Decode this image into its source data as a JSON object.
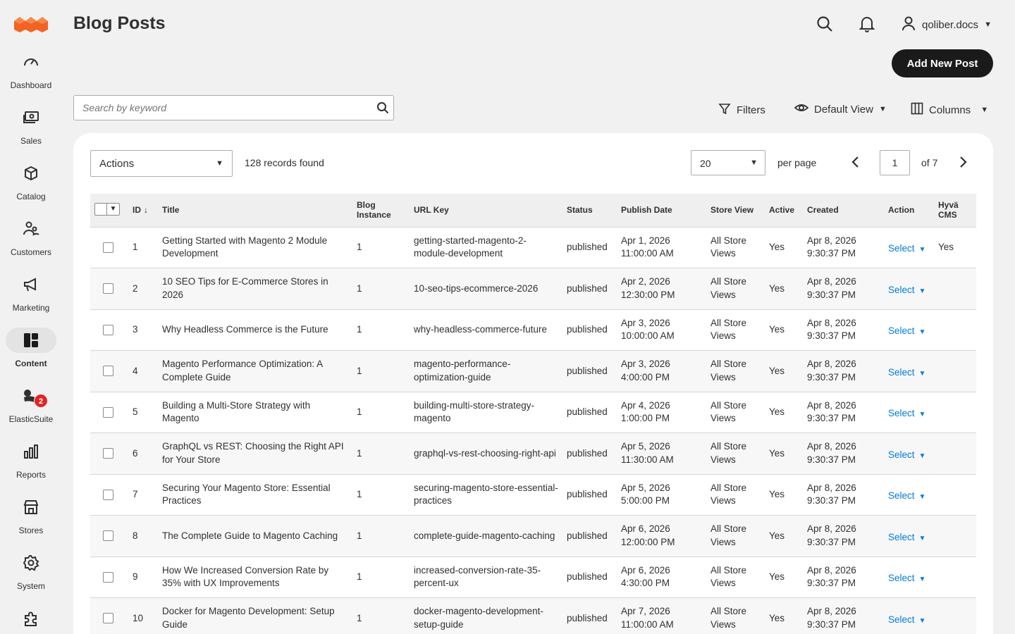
{
  "sidebar": {
    "items": [
      {
        "label": "Dashboard",
        "icon": "dashboard-icon"
      },
      {
        "label": "Sales",
        "icon": "sales-icon"
      },
      {
        "label": "Catalog",
        "icon": "catalog-icon"
      },
      {
        "label": "Customers",
        "icon": "customers-icon"
      },
      {
        "label": "Marketing",
        "icon": "marketing-icon"
      },
      {
        "label": "Content",
        "icon": "content-icon",
        "active": true
      },
      {
        "label": "ElasticSuite",
        "icon": "elasticsuite-icon",
        "badge": "2"
      },
      {
        "label": "Reports",
        "icon": "reports-icon"
      },
      {
        "label": "Stores",
        "icon": "stores-icon"
      },
      {
        "label": "System",
        "icon": "system-icon"
      },
      {
        "label": "",
        "icon": "extensions-icon"
      }
    ]
  },
  "header": {
    "title": "Blog Posts",
    "username": "qoliber.docs",
    "add_button": "Add New Post"
  },
  "search": {
    "placeholder": "Search by keyword"
  },
  "toolbar": {
    "filters": "Filters",
    "view": "Default View",
    "columns": "Columns"
  },
  "grid": {
    "actions_label": "Actions",
    "records_found": "128 records found",
    "per_page_value": "20",
    "per_page_label": "per page",
    "current_page": "1",
    "of_pages": "of 7",
    "columns": {
      "id": "ID",
      "title": "Title",
      "blog_instance": "Blog Instance",
      "url_key": "URL Key",
      "status": "Status",
      "publish_date": "Publish Date",
      "store_view": "Store View",
      "active": "Active",
      "created": "Created",
      "action": "Action",
      "hyva_cms": "Hyvä CMS"
    },
    "rows": [
      {
        "id": "1",
        "title": "Getting Started with Magento 2 Module Development",
        "blog_instance": "1",
        "url_key": "getting-started-magento-2-module-development",
        "status": "published",
        "publish_date": "Apr 1, 2026 11:00:00 AM",
        "store_view": "All Store Views",
        "active": "Yes",
        "created": "Apr 8, 2026 9:30:37 PM",
        "action": "Select",
        "hyva_cms": "Yes"
      },
      {
        "id": "2",
        "title": "10 SEO Tips for E-Commerce Stores in 2026",
        "blog_instance": "1",
        "url_key": "10-seo-tips-ecommerce-2026",
        "status": "published",
        "publish_date": "Apr 2, 2026 12:30:00 PM",
        "store_view": "All Store Views",
        "active": "Yes",
        "created": "Apr 8, 2026 9:30:37 PM",
        "action": "Select",
        "hyva_cms": ""
      },
      {
        "id": "3",
        "title": "Why Headless Commerce is the Future",
        "blog_instance": "1",
        "url_key": "why-headless-commerce-future",
        "status": "published",
        "publish_date": "Apr 3, 2026 10:00:00 AM",
        "store_view": "All Store Views",
        "active": "Yes",
        "created": "Apr 8, 2026 9:30:37 PM",
        "action": "Select",
        "hyva_cms": ""
      },
      {
        "id": "4",
        "title": "Magento Performance Optimization: A Complete Guide",
        "blog_instance": "1",
        "url_key": "magento-performance-optimization-guide",
        "status": "published",
        "publish_date": "Apr 3, 2026 4:00:00 PM",
        "store_view": "All Store Views",
        "active": "Yes",
        "created": "Apr 8, 2026 9:30:37 PM",
        "action": "Select",
        "hyva_cms": ""
      },
      {
        "id": "5",
        "title": "Building a Multi-Store Strategy with Magento",
        "blog_instance": "1",
        "url_key": "building-multi-store-strategy-magento",
        "status": "published",
        "publish_date": "Apr 4, 2026 1:00:00 PM",
        "store_view": "All Store Views",
        "active": "Yes",
        "created": "Apr 8, 2026 9:30:37 PM",
        "action": "Select",
        "hyva_cms": ""
      },
      {
        "id": "6",
        "title": "GraphQL vs REST: Choosing the Right API for Your Store",
        "blog_instance": "1",
        "url_key": "graphql-vs-rest-choosing-right-api",
        "status": "published",
        "publish_date": "Apr 5, 2026 11:30:00 AM",
        "store_view": "All Store Views",
        "active": "Yes",
        "created": "Apr 8, 2026 9:30:37 PM",
        "action": "Select",
        "hyva_cms": ""
      },
      {
        "id": "7",
        "title": "Securing Your Magento Store: Essential Practices",
        "blog_instance": "1",
        "url_key": "securing-magento-store-essential-practices",
        "status": "published",
        "publish_date": "Apr 5, 2026 5:00:00 PM",
        "store_view": "All Store Views",
        "active": "Yes",
        "created": "Apr 8, 2026 9:30:37 PM",
        "action": "Select",
        "hyva_cms": ""
      },
      {
        "id": "8",
        "title": "The Complete Guide to Magento Caching",
        "blog_instance": "1",
        "url_key": "complete-guide-magento-caching",
        "status": "published",
        "publish_date": "Apr 6, 2026 12:00:00 PM",
        "store_view": "All Store Views",
        "active": "Yes",
        "created": "Apr 8, 2026 9:30:37 PM",
        "action": "Select",
        "hyva_cms": ""
      },
      {
        "id": "9",
        "title": "How We Increased Conversion Rate by 35% with UX Improvements",
        "blog_instance": "1",
        "url_key": "increased-conversion-rate-35-percent-ux",
        "status": "published",
        "publish_date": "Apr 6, 2026 4:30:00 PM",
        "store_view": "All Store Views",
        "active": "Yes",
        "created": "Apr 8, 2026 9:30:37 PM",
        "action": "Select",
        "hyva_cms": ""
      },
      {
        "id": "10",
        "title": "Docker for Magento Development: Setup Guide",
        "blog_instance": "1",
        "url_key": "docker-magento-development-setup-guide",
        "status": "published",
        "publish_date": "Apr 7, 2026 11:00:00 AM",
        "store_view": "All Store Views",
        "active": "Yes",
        "created": "Apr 8, 2026 9:30:37 PM",
        "action": "Select",
        "hyva_cms": ""
      }
    ]
  },
  "colors": {
    "brand_orange": "#f26322",
    "link_blue": "#007bdb",
    "badge_red": "#e22626",
    "button_dark": "#1a1a1a"
  }
}
